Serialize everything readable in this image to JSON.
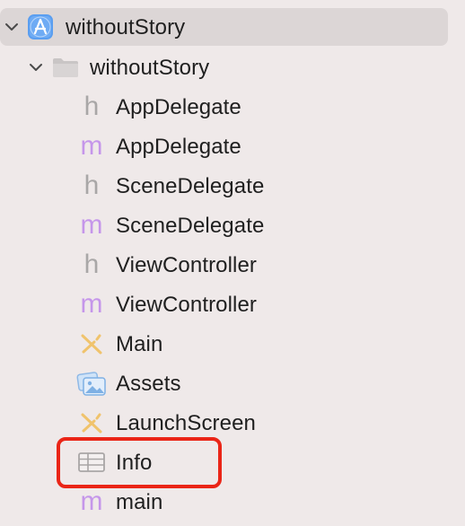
{
  "project": {
    "label": "withoutStory",
    "icon": "app-project-icon",
    "expanded": true
  },
  "group": {
    "label": "withoutStory",
    "icon": "folder-icon",
    "expanded": true
  },
  "files": [
    {
      "label": "AppDelegate",
      "icon": "header-file-icon",
      "glyph": "h"
    },
    {
      "label": "AppDelegate",
      "icon": "objc-implementation-icon",
      "glyph": "m"
    },
    {
      "label": "SceneDelegate",
      "icon": "header-file-icon",
      "glyph": "h"
    },
    {
      "label": "SceneDelegate",
      "icon": "objc-implementation-icon",
      "glyph": "m"
    },
    {
      "label": "ViewController",
      "icon": "header-file-icon",
      "glyph": "h"
    },
    {
      "label": "ViewController",
      "icon": "objc-implementation-icon",
      "glyph": "m"
    },
    {
      "label": "Main",
      "icon": "storyboard-icon"
    },
    {
      "label": "Assets",
      "icon": "asset-catalog-icon"
    },
    {
      "label": "LaunchScreen",
      "icon": "storyboard-icon"
    },
    {
      "label": "Info",
      "icon": "plist-icon"
    },
    {
      "label": "main",
      "icon": "objc-implementation-icon",
      "glyph": "m"
    }
  ],
  "colors": {
    "background": "#efe9e9",
    "selected_row": "#dcd6d6",
    "highlight_border": "#ea2517",
    "header_icon": "#a9a7a7",
    "implementation_icon": "#c596ea",
    "storyboard_icon": "#f0c36c",
    "project_icon": "#5a9ef0"
  }
}
